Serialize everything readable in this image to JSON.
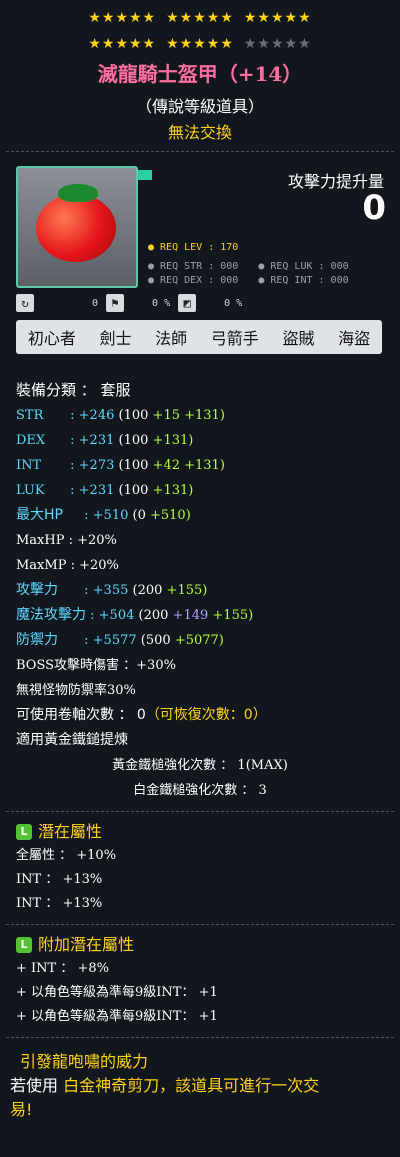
{
  "stars": {
    "row1": [
      5,
      5,
      5
    ],
    "row1_total": [
      5,
      5,
      5
    ],
    "row2_on": [
      5,
      5,
      0
    ],
    "row2_total": [
      5,
      5,
      5
    ]
  },
  "item": {
    "name": "滅龍騎士盔甲（+14）",
    "grade": "（傳說等級道具）",
    "trade": "無法交換",
    "req_lev": "● REQ LEV : 170",
    "req_str": "● REQ STR : 000",
    "req_luk": "● REQ LUK : 000",
    "req_dex": "● REQ DEX : 000",
    "req_int": "● REQ INT : 000",
    "atk_label": "攻擊力提升量",
    "atk_value": "0",
    "mini_a": "0",
    "mini_b": "0 %",
    "mini_c": "0 %",
    "jobs": [
      "初心者",
      "劍士",
      "法師",
      "弓箭手",
      "盜賊",
      "海盜"
    ]
  },
  "stats": {
    "category": "裝備分類 ： 套服",
    "str_label": "STR",
    "str_total": "+246",
    "str_base": "(100",
    "str_flame": "+15",
    "str_star": "+131)",
    "dex_label": "DEX",
    "dex_total": "+231",
    "dex_base": "(100",
    "dex_star": "+131)",
    "int_label": "INT",
    "int_total": "+273",
    "int_base": "(100",
    "int_flame": "+42",
    "int_star": "+131)",
    "luk_label": "LUK",
    "luk_total": "+231",
    "luk_base": "(100",
    "luk_star": "+131)",
    "hp_label": "最大HP",
    "hp_total": "+510",
    "hp_base": "(0",
    "hp_star": "+510)",
    "maxhp_line": "MaxHP : +20%",
    "maxmp_line": "MaxMP : +20%",
    "att_label": "攻擊力",
    "att_total": "+355",
    "att_base": "(200",
    "att_star": "+155)",
    "matt_label": "魔法攻擊力",
    "matt_total": "+504",
    "matt_base": "(200",
    "matt_flame": "+149",
    "matt_star": "+155)",
    "def_label": "防禦力",
    "def_total": "+5577",
    "def_base": "(500",
    "def_star": "+5077)",
    "boss": "BOSS攻擊時傷害 ：+30%",
    "ignore": "無視怪物防禦率30%",
    "scroll_label": "可使用卷軸次數 ： 0",
    "scroll_restore": "（可恢復次數：0）",
    "hammer": "適用黃金鐵鎚提煉",
    "gold_hammer": "黃金鐵槌強化次數 ： 1(MAX)",
    "plat_hammer": "白金鐵槌強化次數 ： 3"
  },
  "potential": {
    "title": "潛在屬性",
    "lines": [
      "全屬性 ： +10%",
      "INT ： +13%",
      "INT ： +13%"
    ]
  },
  "bonus": {
    "title": "附加潛在屬性",
    "lines": [
      "+ INT ： +8%",
      "+ 以角色等級為準每9級INT： +1",
      "+ 以角色等級為準每9級INT： +1"
    ]
  },
  "footer": {
    "line1": "引發龍咆嘯的威力",
    "line2a": "若使用",
    "line2b": "白金神奇剪刀，該道具可進行一次交",
    "line3": "易!"
  },
  "colors": {
    "title": "#ff6ea0",
    "star_on": "#ffd21a",
    "star_off": "#6b6f76",
    "cyan": "#5ed9ff",
    "green": "#b8ff3a",
    "purple": "#a8a6ff"
  }
}
